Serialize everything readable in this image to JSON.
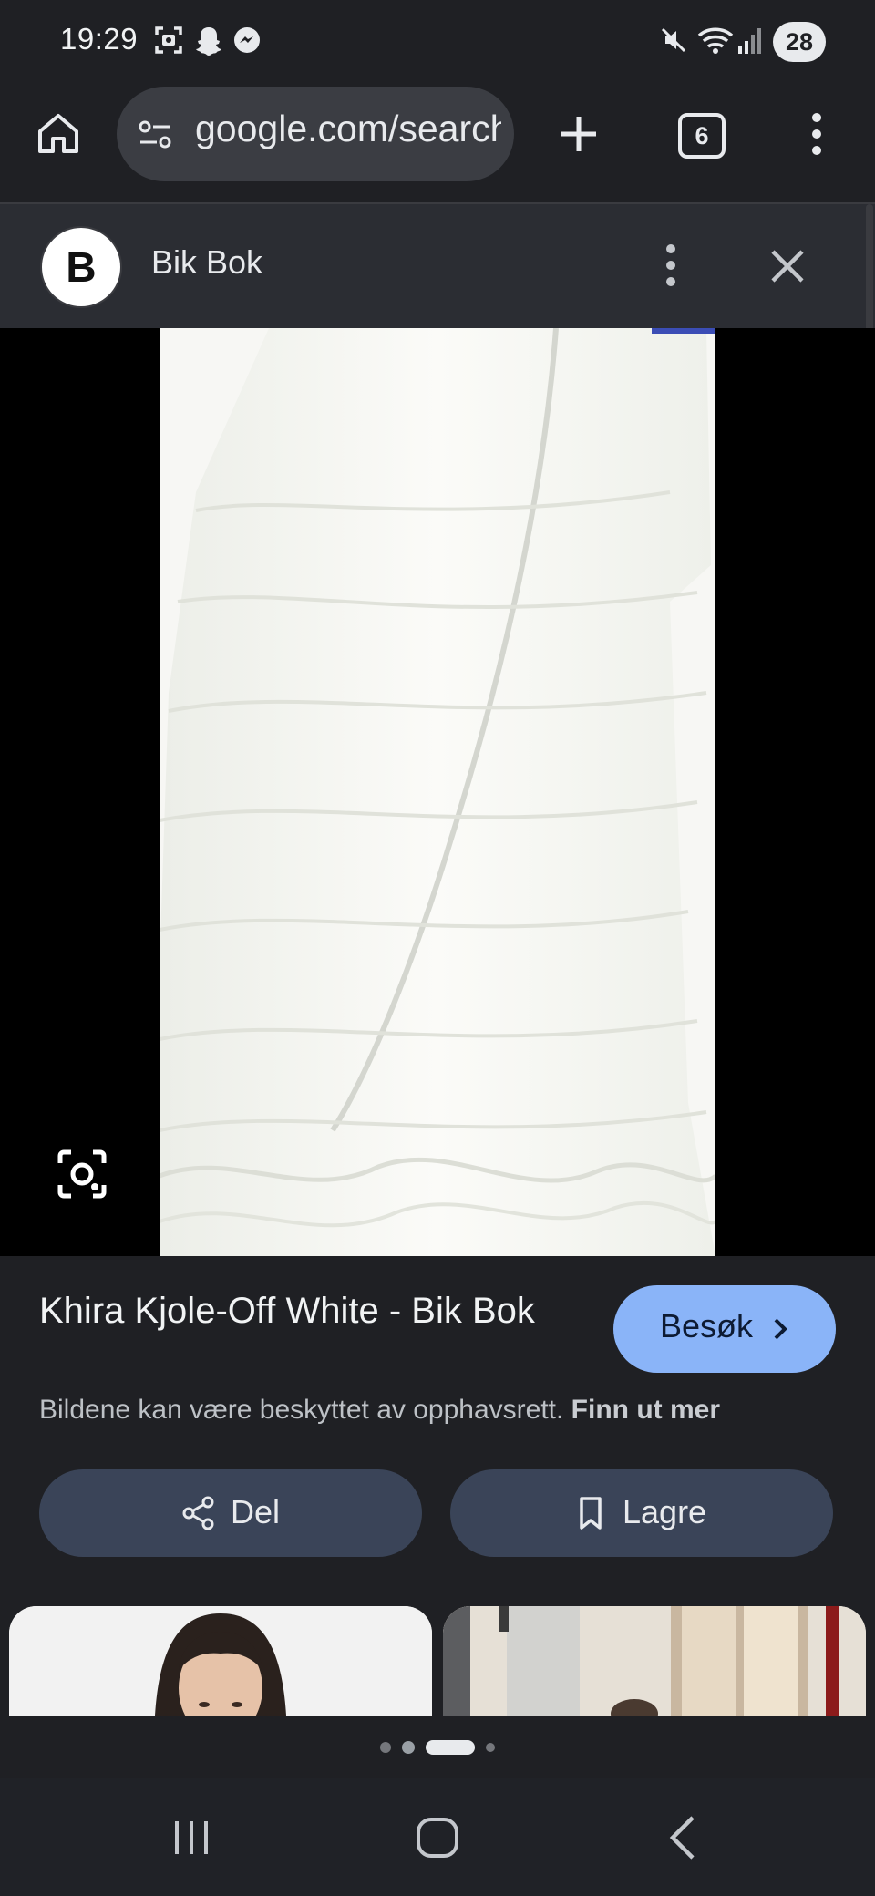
{
  "status_bar": {
    "time": "19:29",
    "battery": "28",
    "icons": [
      "screenshot-icon",
      "snapchat-icon",
      "messenger-icon",
      "mute-icon",
      "wifi-icon",
      "signal-icon"
    ]
  },
  "browser": {
    "url": "google.com/search",
    "tab_count": "6",
    "icons": [
      "home-icon",
      "site-info-icon",
      "new-tab-icon",
      "tabs-icon",
      "more-vert-icon"
    ]
  },
  "source": {
    "logo_letter": "B",
    "name": "Bik Bok"
  },
  "result": {
    "title": "Khira Kjole-Off White - Bik Bok",
    "visit_label": "Besøk",
    "copyright_text": "Bildene kan være beskyttet av opphavsrett.",
    "learn_more": "Finn ut mer",
    "share_label": "Del",
    "save_label": "Lagre"
  },
  "pager": {
    "active_index": 2,
    "count": 4
  },
  "colors": {
    "background": "#1f2024",
    "header": "#2b2d33",
    "accent_button": "#8ab4f8",
    "action_button": "#3a4458"
  }
}
